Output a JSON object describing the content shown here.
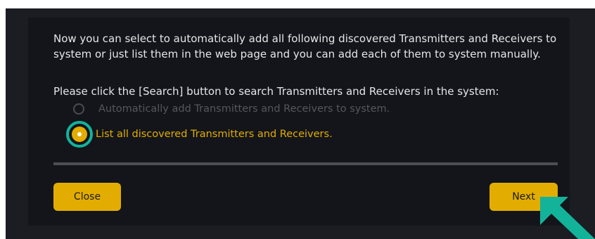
{
  "dialog": {
    "intro_text": "Now you can select to automatically add all following discovered Transmitters and Receivers to system or just list them in the web page and you can add each of them to system manually.",
    "instruction_text": "Please click the [Search] button to search Transmitters and Receivers in the system:",
    "options": [
      {
        "label": "Automatically add Transmitters and Receivers to system.",
        "selected": false
      },
      {
        "label": "List all discovered Transmitters and Receivers.",
        "selected": true
      }
    ],
    "buttons": {
      "close_label": "Close",
      "next_label": "Next"
    }
  },
  "colors": {
    "accent": "#e2ad00",
    "highlight": "#13b39a",
    "panel_bg": "#13151b",
    "text": "#e6e6e6",
    "disabled_text": "#55575d"
  },
  "icons": {
    "pointer": "arrow-pointer-icon",
    "radio_selected": "radio-selected-icon",
    "radio_unselected": "radio-unselected-icon"
  }
}
